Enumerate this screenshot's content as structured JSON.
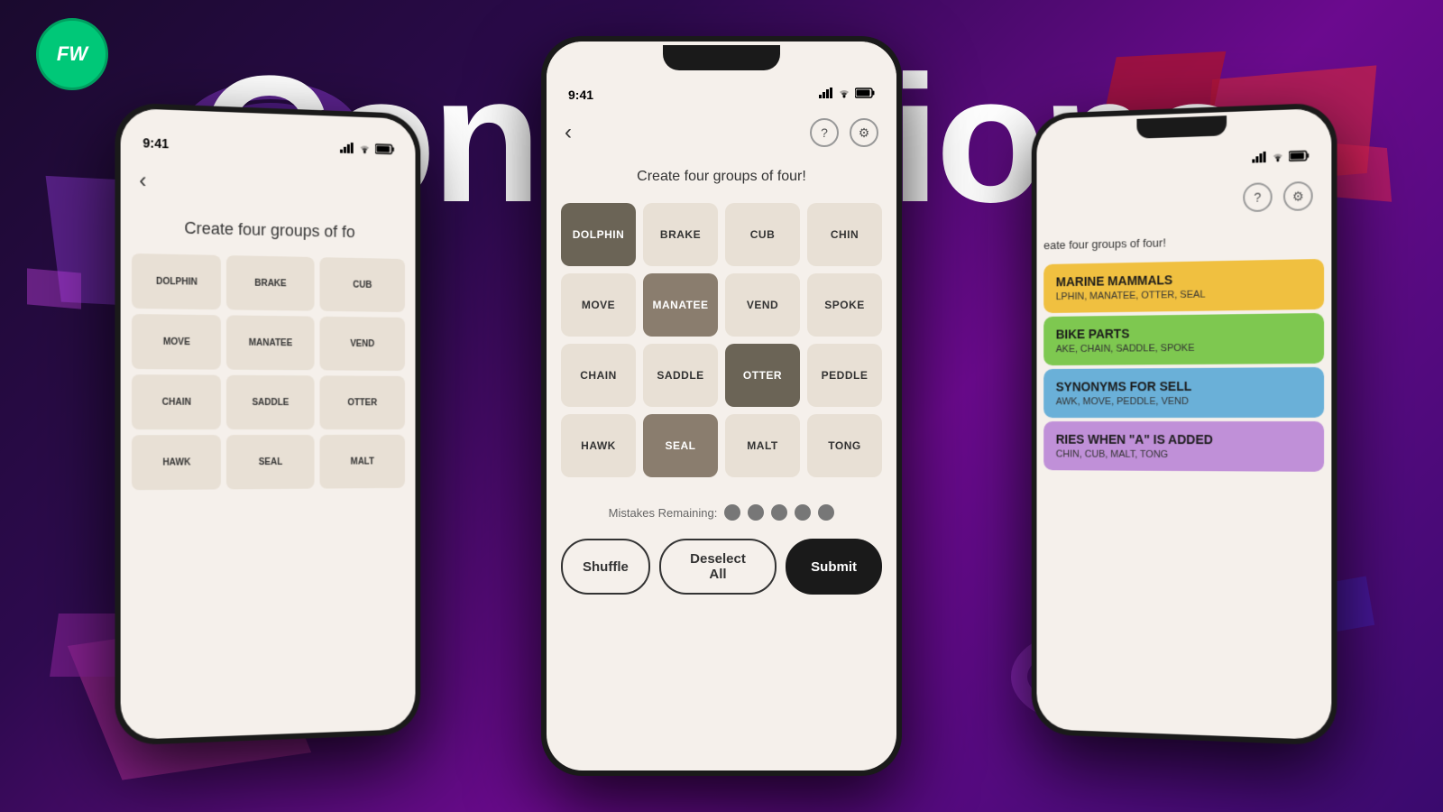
{
  "background": {
    "title": "Connections",
    "color_main": "#2d0a4e"
  },
  "logo": {
    "text": "FW",
    "bg_color": "#00c878"
  },
  "phone_center": {
    "status_time": "9:41",
    "game_title": "Create four groups of four!",
    "tiles": [
      {
        "word": "DOLPHIN",
        "state": "selected-dark"
      },
      {
        "word": "BRAKE",
        "state": "normal"
      },
      {
        "word": "CUB",
        "state": "normal"
      },
      {
        "word": "CHIN",
        "state": "normal"
      },
      {
        "word": "MOVE",
        "state": "normal"
      },
      {
        "word": "MANATEE",
        "state": "selected-medium"
      },
      {
        "word": "VEND",
        "state": "normal"
      },
      {
        "word": "SPOKE",
        "state": "normal"
      },
      {
        "word": "CHAIN",
        "state": "normal"
      },
      {
        "word": "SADDLE",
        "state": "normal"
      },
      {
        "word": "OTTER",
        "state": "selected-dark"
      },
      {
        "word": "PEDDLE",
        "state": "normal"
      },
      {
        "word": "HAWK",
        "state": "normal"
      },
      {
        "word": "SEAL",
        "state": "selected-medium"
      },
      {
        "word": "MALT",
        "state": "normal"
      },
      {
        "word": "TONG",
        "state": "normal"
      }
    ],
    "mistakes_label": "Mistakes Remaining:",
    "mistake_dots": 5,
    "btn_shuffle": "Shuffle",
    "btn_deselect": "Deselect All",
    "btn_submit": "Submit"
  },
  "phone_left": {
    "status_time": "9:41",
    "game_title": "Create four groups of fo",
    "tiles": [
      {
        "word": "DOLPHIN"
      },
      {
        "word": "BRAKE"
      },
      {
        "word": "CUB"
      },
      {
        "word": "MOVE"
      },
      {
        "word": "MANATEE"
      },
      {
        "word": "VEND"
      },
      {
        "word": "CHAIN"
      },
      {
        "word": "SADDLE"
      },
      {
        "word": "OTTER"
      },
      {
        "word": "HAWK"
      },
      {
        "word": "SEAL"
      },
      {
        "word": "MALT"
      }
    ]
  },
  "phone_right": {
    "game_title": "eate four groups of four!",
    "categories": [
      {
        "title": "MARINE MAMMALS",
        "words": "LPHIN, MANATEE, OTTER, SEAL",
        "color": "yellow"
      },
      {
        "title": "BIKE PARTS",
        "words": "AKE, CHAIN, SADDLE, SPOKE",
        "color": "green"
      },
      {
        "title": "SYNONYMS FOR SELL",
        "words": "AWK, MOVE, PEDDLE, VEND",
        "color": "blue"
      },
      {
        "title": "RIES WHEN \"A\" IS ADDED",
        "words": "CHIN, CUB, MALT, TONG",
        "color": "purple"
      }
    ]
  }
}
